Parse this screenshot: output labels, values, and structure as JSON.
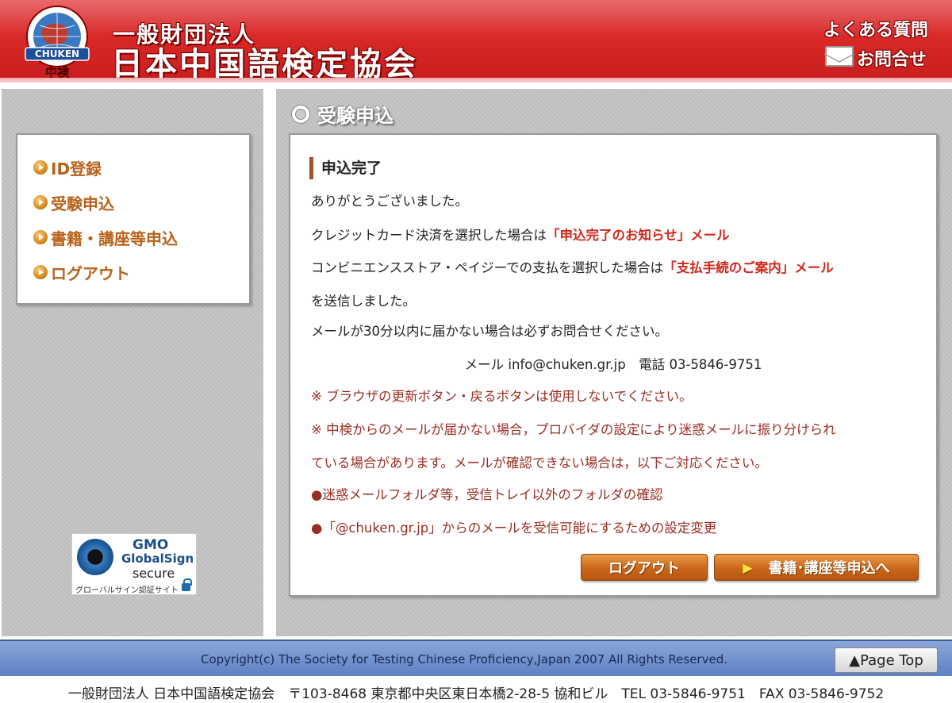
{
  "header": {
    "logo_text": "CHUKEN",
    "logo_sub": "中検",
    "org_sub": "一般財団法人",
    "org_main": "日本中国語検定協会",
    "faq_label": "よくある質問",
    "contact_label": "お問合せ"
  },
  "sidebar": {
    "items": [
      {
        "label": "ID登録"
      },
      {
        "label": "受験申込"
      },
      {
        "label": "書籍・講座等申込"
      },
      {
        "label": "ログアウト"
      }
    ],
    "seal": {
      "brand": "GMO",
      "name": "GlobalSign",
      "secure": "secure",
      "caption": "グローバルサイン認証サイト"
    }
  },
  "main": {
    "title": "受験申込",
    "section_title": "申込完了",
    "thanks": "ありがとうございました。",
    "credit_prefix": "クレジットカード決済を選択した場合は",
    "credit_mail": "「申込完了のお知らせ」メール",
    "conv_prefix": "コンビニエンスストア・ペイジーでの支払を選択した場合は",
    "conv_mail": "「支払手続のご案内」メール",
    "sent": "を送信しました。",
    "notice": "メールが30分以内に届かない場合は必ずお問合せください。",
    "contact_line": "メール info@chuken.gr.jp　電話 03-5846-9751",
    "warn1": "※ ブラウザの更新ボタン・戻るボタンは使用しないでください。",
    "warn2a": "※ 中検からのメールが届かない場合，プロバイダの設定により迷惑メールに振り分けられ",
    "warn2b": "ている場合があります。メールが確認できない場合は，以下ご対応ください。",
    "bullet1": "●迷惑メールフォルダ等，受信トレイ以外のフォルダの確認",
    "bullet2": "●「@chuken.gr.jp」からのメールを受信可能にするための設定変更",
    "logout_button": "ログアウト",
    "books_button": "書籍･講座等申込へ"
  },
  "footer": {
    "copyright": "Copyright(c) The Society for Testing Chinese Proficiency,Japan 2007 All Rights Reserved.",
    "page_top": "▲Page Top",
    "address": "一般財団法人 日本中国語検定協会　〒103-8468 東京都中央区東日本橋2-28-5 協和ビル　TEL 03-5846-9751　FAX 03-5846-9752"
  },
  "colors": {
    "header_red": "#d92828",
    "menu_orange": "#b8621a",
    "emphasis_red": "#d0281c",
    "footer_blue": "#6a8cc9"
  }
}
